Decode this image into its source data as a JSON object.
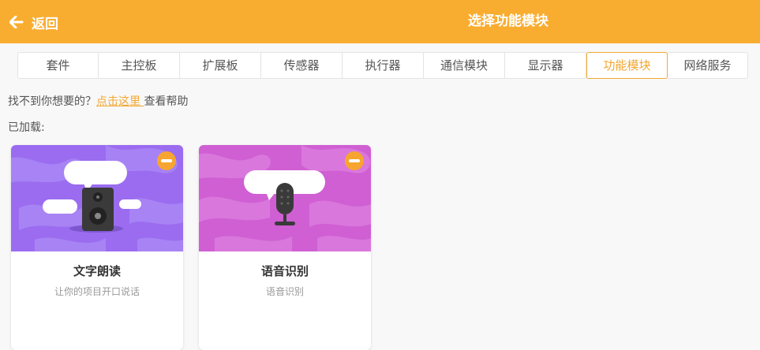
{
  "header": {
    "back_label": "返回",
    "title": "选择功能模块"
  },
  "tabs": [
    {
      "label": "套件"
    },
    {
      "label": "主控板"
    },
    {
      "label": "扩展板"
    },
    {
      "label": "传感器"
    },
    {
      "label": "执行器"
    },
    {
      "label": "通信模块"
    },
    {
      "label": "显示器"
    },
    {
      "label": "功能模块",
      "active": true
    },
    {
      "label": "网络服务"
    }
  ],
  "help": {
    "prefix": "找不到你想要的？",
    "link": "点击这里 ",
    "suffix": "查看帮助"
  },
  "loaded_label": "已加载:",
  "cards": [
    {
      "title": "文字朗读",
      "desc": "让你的项目开口说话",
      "icon": "speaker-icon",
      "bg": "#9b6cf0"
    },
    {
      "title": "语音识别",
      "desc": "语音识别",
      "icon": "microphone-icon",
      "bg": "#cf5fd3"
    }
  ],
  "colors": {
    "accent": "#f9ad30",
    "active_tab": "#f2a731"
  }
}
